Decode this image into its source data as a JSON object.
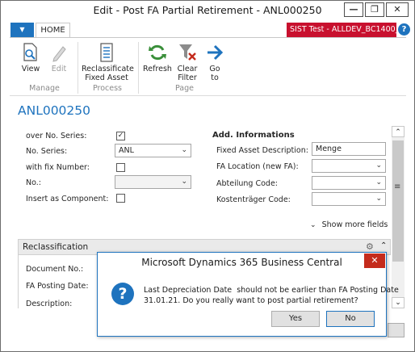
{
  "window": {
    "title": "Edit - Post FA Partial Retirement - ANL000250",
    "minimize_label": "—",
    "restore_label": "❐",
    "close_label": "✕"
  },
  "ribbon": {
    "file_menu_icon": "caret-down-icon",
    "tab_home": "HOME",
    "company_badge": "SIST Test - ALLDEV_BC1400_...",
    "help_label": "?",
    "buttons": {
      "view": "View",
      "edit": "Edit",
      "reclassificate_line1": "Reclassificate",
      "reclassificate_line2": "Fixed Asset",
      "refresh": "Refresh",
      "clear_filter_line1": "Clear",
      "clear_filter_line2": "Filter",
      "goto_line1": "Go",
      "goto_line2": "to"
    },
    "groups": {
      "manage": "Manage",
      "process": "Process",
      "page": "Page"
    }
  },
  "page": {
    "record_id": "ANL000250",
    "fields_left": {
      "over_no_series_label": "over No. Series:",
      "over_no_series_checked": true,
      "no_series_label": "No. Series:",
      "no_series_value": "ANL",
      "with_fix_number_label": "with fix Number:",
      "no_label": "No.:",
      "insert_as_component_label": "Insert as Component:"
    },
    "fields_right": {
      "section_title": "Add. Informations",
      "fa_description_label": "Fixed Asset Description:",
      "fa_description_value": "Menge",
      "fa_location_label": "FA Location (new FA):",
      "abteilung_label": "Abteilung Code:",
      "kostentraeger_label": "Kostenträger Code:",
      "show_more": "Show more fields"
    },
    "reclassification": {
      "title": "Reclassification",
      "document_no_label": "Document No.:",
      "fa_posting_date_label": "FA Posting Date:",
      "description_label": "Description:"
    }
  },
  "dialog": {
    "title": "Microsoft Dynamics 365 Business Central",
    "icon": "question-icon",
    "message_line1": "Last Depreciation Date  should not be earlier than FA Posting Date",
    "message_line2": "31.01.21. Do you really want to post partial retirement?",
    "yes_label": "Yes",
    "no_label": "No"
  },
  "colors": {
    "accent": "#1e73be",
    "company_badge": "#c8102e",
    "dialog_close": "#c42b1c",
    "refresh_green": "#3a8f3a"
  }
}
